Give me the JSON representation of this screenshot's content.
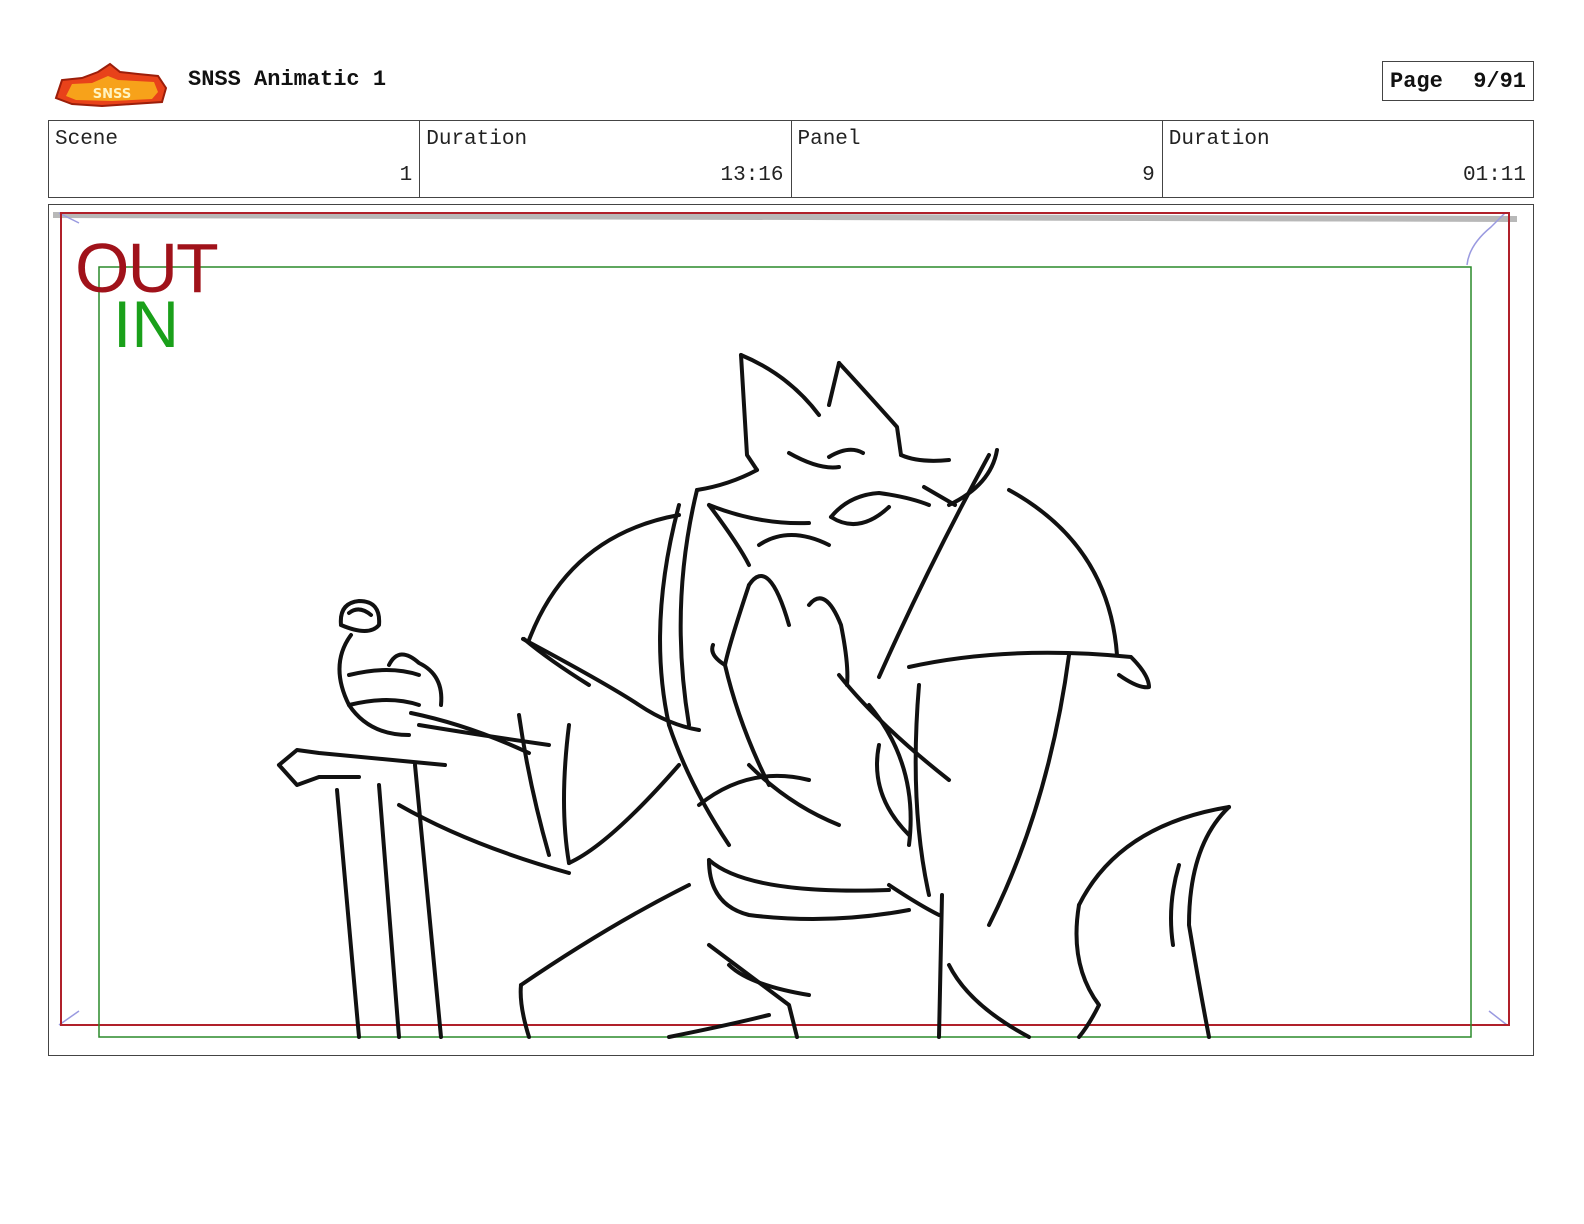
{
  "header": {
    "logo_name": "sir-logo",
    "doc_title": "SNSS Animatic 1",
    "page_label": "Page",
    "page_value": "9/91"
  },
  "info": {
    "scene_label": "Scene",
    "scene_value": "1",
    "scene_duration_label": "Duration",
    "scene_duration_value": "13:16",
    "panel_label": "Panel",
    "panel_value": "9",
    "panel_duration_label": "Duration",
    "panel_duration_value": "01:11"
  },
  "frame": {
    "out_label": "OUT",
    "in_label": "IN",
    "out_color": "#a0121a",
    "in_color": "#1aa01a"
  }
}
